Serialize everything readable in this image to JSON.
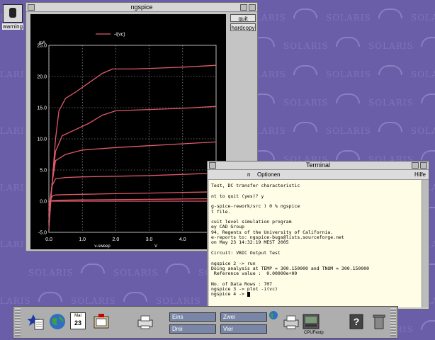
{
  "wallpaper": {
    "word": "SOLARIS"
  },
  "desktop_icon": {
    "label": "warning"
  },
  "plot_window": {
    "title": "ngspice",
    "buttons": {
      "quit": "quit",
      "hardcopy": "hardcopy"
    }
  },
  "chart_data": {
    "type": "line",
    "xlabel": "V",
    "ylabel": "mA",
    "xname": "v-sweep",
    "xlim": [
      0,
      5
    ],
    "ylim": [
      -5,
      25
    ],
    "xticks": [
      "0.0",
      "1.0",
      "2.0",
      "3.0",
      "4.0",
      "5.0"
    ],
    "yticks": [
      "-5.0",
      "0.0",
      "5.0",
      "10.0",
      "15.0",
      "20.0",
      "25.0"
    ],
    "grid": true,
    "legend": "top-left",
    "series": [
      {
        "name": "-i(vc)",
        "color": "#e05a6a",
        "x": [
          0,
          0.1,
          0.2,
          0.3,
          0.5,
          0.8,
          1.2,
          1.6,
          1.9,
          2.5,
          3.0,
          4.0,
          5.0
        ],
        "y": [
          -4.5,
          3,
          10,
          14.5,
          16.5,
          17.5,
          19,
          20.5,
          21.2,
          21.2,
          21.3,
          21.5,
          21.8
        ]
      },
      {
        "x": [
          0,
          0.1,
          0.2,
          0.4,
          0.8,
          1.2,
          1.6,
          2.0,
          3.0,
          4.0,
          5.0
        ],
        "y": [
          -3,
          3,
          8,
          10.5,
          11.5,
          12.5,
          13.8,
          14.5,
          14.7,
          14.9,
          15.2
        ]
      },
      {
        "x": [
          0,
          0.1,
          0.2,
          0.5,
          1.0,
          2.0,
          3.0,
          4.0,
          5.0
        ],
        "y": [
          -2,
          3,
          6.5,
          7.5,
          8.2,
          8.6,
          8.9,
          9.2,
          9.5
        ]
      },
      {
        "x": [
          0,
          0.1,
          0.2,
          0.5,
          1.0,
          2.0,
          3.0,
          4.0,
          5.0
        ],
        "y": [
          -1,
          2.5,
          3.6,
          3.8,
          3.9,
          4.0,
          4.1,
          4.3,
          4.5
        ]
      },
      {
        "x": [
          0,
          0.1,
          0.2,
          0.5,
          1.0,
          2.0,
          3.0,
          4.0,
          5.0
        ],
        "y": [
          -0.5,
          0.8,
          1.0,
          1.05,
          1.1,
          1.2,
          1.3,
          1.4,
          1.5
        ]
      },
      {
        "x": [
          0,
          0.1,
          0.3,
          1.0,
          2.0,
          3.0,
          4.0,
          5.0
        ],
        "y": [
          -0.2,
          0.1,
          0.15,
          0.2,
          0.25,
          0.3,
          0.35,
          0.4
        ]
      },
      {
        "x": [
          0,
          0.2,
          1.0,
          2.0,
          3.0,
          4.0,
          5.0
        ],
        "y": [
          0,
          0,
          0,
          0,
          0,
          0,
          0
        ]
      }
    ]
  },
  "terminal": {
    "title": "Terminal",
    "menu": {
      "left": "n",
      "options": "Optionen",
      "help": "Hilfe"
    },
    "lines": [
      "Test, DC transfer characteristic",
      "",
      "nt to quit (yes)? y",
      "",
      "g-spice-rework/src ) 0 % ngspice",
      "t file.",
      "",
      "cuit level simulation program",
      "ey CAD Group",
      "94, Regents of the University of California.",
      "e-reports to: ngspice-bugs@lists.sourceforge.net",
      "on May 23 14:32:19 MEST 2005",
      "",
      "Circuit: VBIC Output Test",
      "",
      "ngspice 2 -> run",
      "Doing analysis at TEMP = 300.150000 and TNOM = 300.150000",
      " Reference value :  0.00000e+00",
      "",
      "No. of Data Rows : 707",
      "ngspice 3 -> plot -i(vc)",
      "ngspice 4 -> "
    ]
  },
  "dock": {
    "calendar": {
      "month": "Mai",
      "day": "23"
    },
    "workspaces": [
      "Eins",
      "Zwei",
      "Drei",
      "Vier"
    ],
    "app_label": "CPUFextp"
  }
}
